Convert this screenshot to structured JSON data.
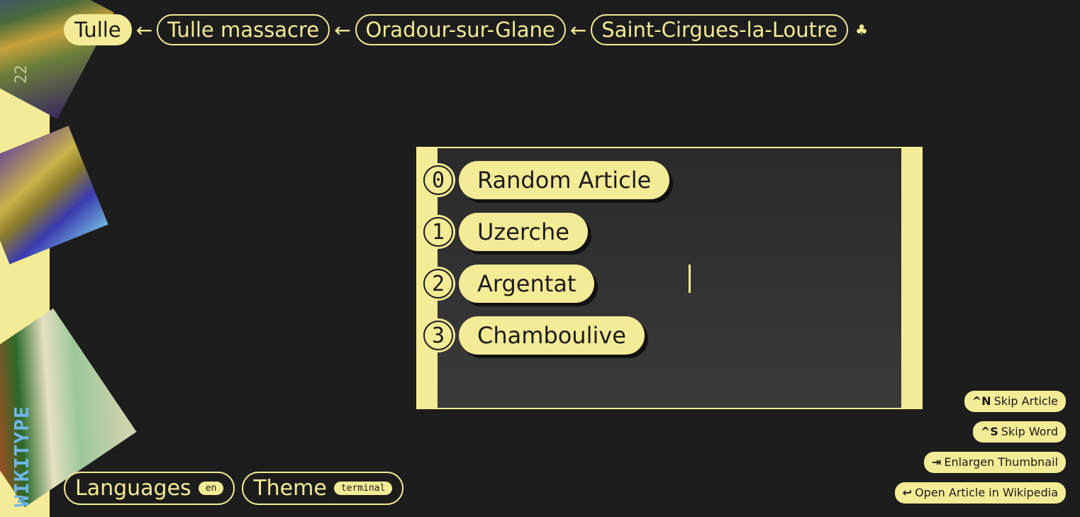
{
  "brand": {
    "name": "WIKITYPE",
    "side_label": "22"
  },
  "breadcrumb": {
    "items": [
      {
        "label": "Tulle"
      },
      {
        "label": "Tulle massacre"
      },
      {
        "label": "Oradour-sur-Glane"
      },
      {
        "label": "Saint-Cirgues-la-Loutre"
      }
    ],
    "separator": "←",
    "tree_icon": "♣"
  },
  "options": [
    {
      "number": "0",
      "label": "Random Article"
    },
    {
      "number": "1",
      "label": "Uzerche"
    },
    {
      "number": "2",
      "label": "Argentat"
    },
    {
      "number": "3",
      "label": "Chamboulive"
    }
  ],
  "footer": {
    "languages_label": "Languages",
    "languages_tag": "en",
    "theme_label": "Theme",
    "theme_tag": "terminal"
  },
  "shortcuts": [
    {
      "key": "^N",
      "label": "Skip Article"
    },
    {
      "key": "^S",
      "label": "Skip Word"
    },
    {
      "key": "⇥",
      "label": "Enlargen Thumbnail"
    },
    {
      "key": "↩",
      "label": "Open Article in Wikipedia"
    }
  ],
  "colors": {
    "accent": "#f4eb96",
    "background": "#1b1b1b"
  }
}
